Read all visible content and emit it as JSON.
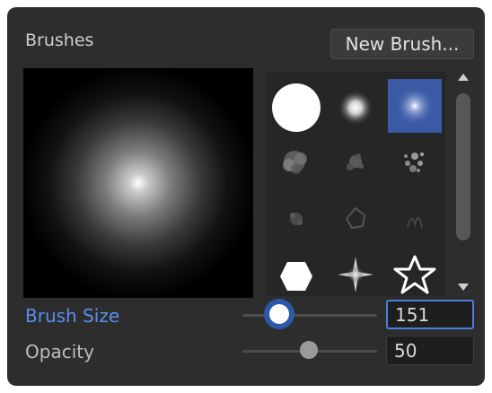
{
  "panel": {
    "title": "Brushes",
    "new_brush_label": "New Brush...",
    "selected_brush": "soft-round-small"
  },
  "brushes": [
    {
      "name": "hard-round",
      "selected": false
    },
    {
      "name": "soft-round-small",
      "selected": false
    },
    {
      "name": "soft-round-glow",
      "selected": true
    },
    {
      "name": "cloud-texture",
      "selected": false
    },
    {
      "name": "splatter-texture",
      "selected": false
    },
    {
      "name": "spray-texture",
      "selected": false
    },
    {
      "name": "sparkle-texture",
      "selected": false
    },
    {
      "name": "cell-texture",
      "selected": false
    },
    {
      "name": "smoke-texture",
      "selected": false
    },
    {
      "name": "hexagon",
      "selected": false
    },
    {
      "name": "star-burst",
      "selected": false
    },
    {
      "name": "star-outline",
      "selected": false
    }
  ],
  "controls": {
    "brush_size_label": "Brush Size",
    "brush_size_value": "151",
    "opacity_label": "Opacity",
    "opacity_value": "50",
    "brush_size_slider_fraction": 0.27,
    "opacity_slider_fraction": 0.49
  },
  "colors": {
    "accent": "#4a7ee0",
    "panel_bg": "#2d2d2d"
  }
}
